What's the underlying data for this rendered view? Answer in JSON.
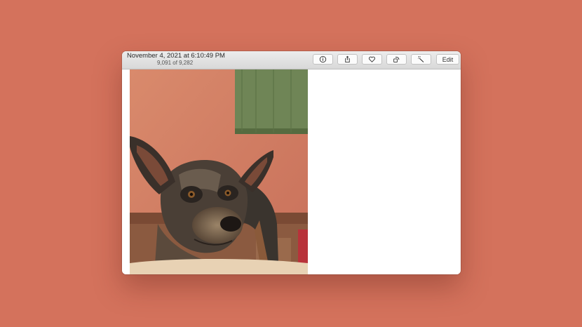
{
  "window": {
    "title_date": "November 4, 2021 at 6:10:49 PM",
    "photo_counter": "9,091 of 9,282"
  },
  "toolbar": {
    "info_icon": "info-circle",
    "share_icon": "share-box-arrow",
    "favorite_icon": "heart-outline",
    "rotate_icon": "rotate-square-arrow",
    "enhance_icon": "magic-wand",
    "edit_label": "Edit"
  },
  "photo": {
    "subject": "dog-photo"
  },
  "colors": {
    "desktop_background": "#d4725c",
    "titlebar": "#e2e2e2",
    "window": "#ffffff"
  }
}
